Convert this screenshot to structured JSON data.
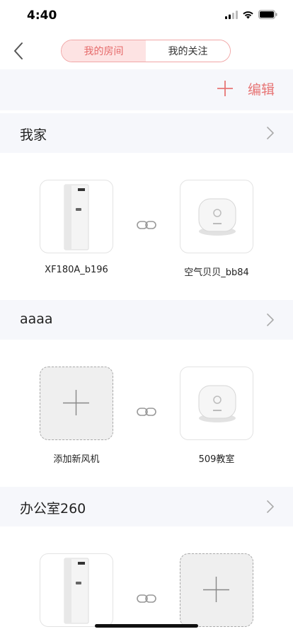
{
  "status_bar": {
    "time": "4:40"
  },
  "tabs": [
    {
      "label": "我的房间",
      "active": true
    },
    {
      "label": "我的关注",
      "active": false
    }
  ],
  "toolbar": {
    "edit_label": "编辑"
  },
  "colors": {
    "accent": "#e66a6a",
    "segment_active_bg": "#fde3e3",
    "section_bg": "#f6f7fb"
  },
  "rooms": [
    {
      "name": "我家",
      "devices": [
        {
          "label": "XF180A_b196",
          "kind": "fresh-air-unit"
        },
        {
          "label": "空气贝贝_bb84",
          "kind": "air-monitor"
        }
      ]
    },
    {
      "name": "aaaa",
      "devices": [
        {
          "label": "添加新风机",
          "kind": "add-placeholder"
        },
        {
          "label": "509教室",
          "kind": "air-monitor"
        }
      ]
    },
    {
      "name": "办公室260",
      "devices": [
        {
          "label": "",
          "kind": "fresh-air-unit"
        },
        {
          "label": "",
          "kind": "add-placeholder"
        }
      ]
    }
  ]
}
